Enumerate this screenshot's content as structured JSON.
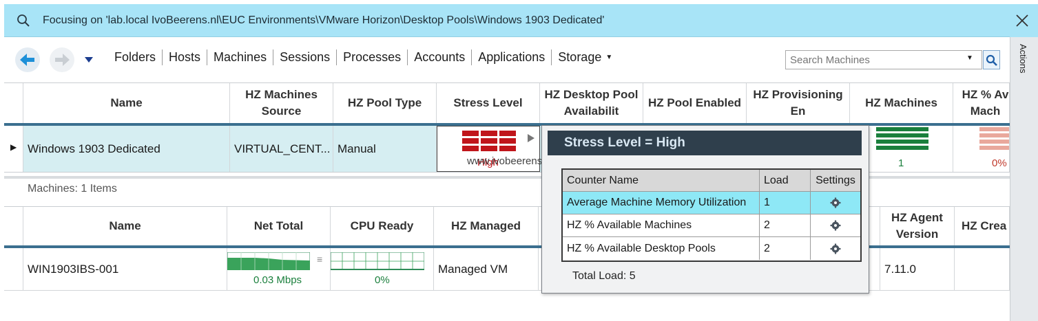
{
  "focus": {
    "text": "Focusing on 'lab.local IvoBeerens.nl\\EUC Environments\\VMware Horizon\\Desktop Pools\\Windows 1903 Dedicated'"
  },
  "actions_label": "Actions",
  "tabs": [
    "Folders",
    "Hosts",
    "Machines",
    "Sessions",
    "Processes",
    "Accounts",
    "Applications",
    "Storage"
  ],
  "search": {
    "placeholder": "Search Machines"
  },
  "top_table": {
    "headers": [
      "Name",
      "HZ Machines Source",
      "HZ Pool Type",
      "Stress Level",
      "HZ Desktop Pool Availabilit",
      "HZ Pool Enabled",
      "HZ Provisioning En",
      "HZ Machines",
      "HZ % Av Mach"
    ],
    "row": {
      "name": "Windows 1903 Dedicated",
      "source": "VIRTUAL_CENT...",
      "pool_type": "Manual",
      "stress": "High",
      "machines": "1",
      "pct_available": "0%"
    }
  },
  "watermark": "www.ivobeerens.nl",
  "machines_count": "Machines: 1 Items",
  "bottom_table": {
    "headers": [
      "Name",
      "Net Total",
      "CPU Ready",
      "HZ Managed",
      "HZ Agent Version",
      "HZ Crea"
    ],
    "row": {
      "name": "WIN1903IBS-001",
      "net_total": "0.03 Mbps",
      "cpu_ready": "0%",
      "managed": "Managed VM",
      "agent_version": "7.11.0"
    }
  },
  "popup": {
    "title": "Stress Level = High",
    "columns": [
      "Counter Name",
      "Load",
      "Settings"
    ],
    "rows": [
      {
        "name": "Average Machine Memory Utilization",
        "load": "1"
      },
      {
        "name": "HZ % Available Machines",
        "load": "2"
      },
      {
        "name": "HZ % Available Desktop Pools",
        "load": "2"
      }
    ],
    "total": "Total Load: 5"
  },
  "colors": {
    "focus_bar": "#a8e4f7",
    "header_underline": "#3b6f8f",
    "selected_row": "#d6eef2",
    "stress_high": "#c0151b",
    "machines_green": "#1a7f3c",
    "popup_title_bg": "#2f3f4c",
    "popup_selected": "#8ee8f6"
  }
}
